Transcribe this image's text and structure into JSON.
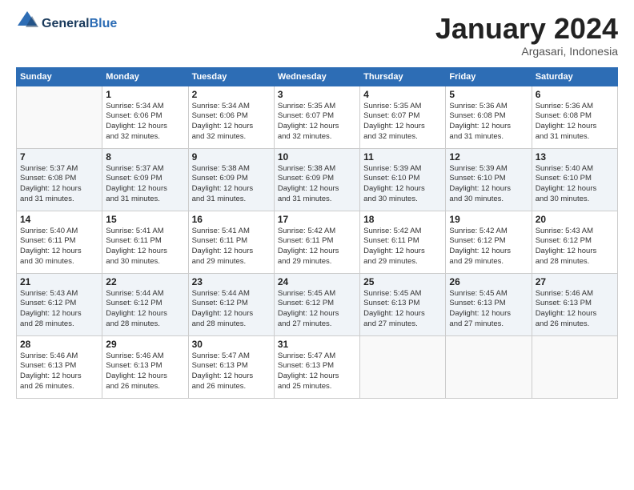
{
  "header": {
    "logo_line1": "General",
    "logo_line2": "Blue",
    "month_title": "January 2024",
    "subtitle": "Argasari, Indonesia"
  },
  "days_of_week": [
    "Sunday",
    "Monday",
    "Tuesday",
    "Wednesday",
    "Thursday",
    "Friday",
    "Saturday"
  ],
  "weeks": [
    [
      {
        "day": "",
        "info": ""
      },
      {
        "day": "1",
        "info": "Sunrise: 5:34 AM\nSunset: 6:06 PM\nDaylight: 12 hours\nand 32 minutes."
      },
      {
        "day": "2",
        "info": "Sunrise: 5:34 AM\nSunset: 6:06 PM\nDaylight: 12 hours\nand 32 minutes."
      },
      {
        "day": "3",
        "info": "Sunrise: 5:35 AM\nSunset: 6:07 PM\nDaylight: 12 hours\nand 32 minutes."
      },
      {
        "day": "4",
        "info": "Sunrise: 5:35 AM\nSunset: 6:07 PM\nDaylight: 12 hours\nand 32 minutes."
      },
      {
        "day": "5",
        "info": "Sunrise: 5:36 AM\nSunset: 6:08 PM\nDaylight: 12 hours\nand 31 minutes."
      },
      {
        "day": "6",
        "info": "Sunrise: 5:36 AM\nSunset: 6:08 PM\nDaylight: 12 hours\nand 31 minutes."
      }
    ],
    [
      {
        "day": "7",
        "info": "Sunrise: 5:37 AM\nSunset: 6:08 PM\nDaylight: 12 hours\nand 31 minutes."
      },
      {
        "day": "8",
        "info": "Sunrise: 5:37 AM\nSunset: 6:09 PM\nDaylight: 12 hours\nand 31 minutes."
      },
      {
        "day": "9",
        "info": "Sunrise: 5:38 AM\nSunset: 6:09 PM\nDaylight: 12 hours\nand 31 minutes."
      },
      {
        "day": "10",
        "info": "Sunrise: 5:38 AM\nSunset: 6:09 PM\nDaylight: 12 hours\nand 31 minutes."
      },
      {
        "day": "11",
        "info": "Sunrise: 5:39 AM\nSunset: 6:10 PM\nDaylight: 12 hours\nand 30 minutes."
      },
      {
        "day": "12",
        "info": "Sunrise: 5:39 AM\nSunset: 6:10 PM\nDaylight: 12 hours\nand 30 minutes."
      },
      {
        "day": "13",
        "info": "Sunrise: 5:40 AM\nSunset: 6:10 PM\nDaylight: 12 hours\nand 30 minutes."
      }
    ],
    [
      {
        "day": "14",
        "info": "Sunrise: 5:40 AM\nSunset: 6:11 PM\nDaylight: 12 hours\nand 30 minutes."
      },
      {
        "day": "15",
        "info": "Sunrise: 5:41 AM\nSunset: 6:11 PM\nDaylight: 12 hours\nand 30 minutes."
      },
      {
        "day": "16",
        "info": "Sunrise: 5:41 AM\nSunset: 6:11 PM\nDaylight: 12 hours\nand 29 minutes."
      },
      {
        "day": "17",
        "info": "Sunrise: 5:42 AM\nSunset: 6:11 PM\nDaylight: 12 hours\nand 29 minutes."
      },
      {
        "day": "18",
        "info": "Sunrise: 5:42 AM\nSunset: 6:11 PM\nDaylight: 12 hours\nand 29 minutes."
      },
      {
        "day": "19",
        "info": "Sunrise: 5:42 AM\nSunset: 6:12 PM\nDaylight: 12 hours\nand 29 minutes."
      },
      {
        "day": "20",
        "info": "Sunrise: 5:43 AM\nSunset: 6:12 PM\nDaylight: 12 hours\nand 28 minutes."
      }
    ],
    [
      {
        "day": "21",
        "info": "Sunrise: 5:43 AM\nSunset: 6:12 PM\nDaylight: 12 hours\nand 28 minutes."
      },
      {
        "day": "22",
        "info": "Sunrise: 5:44 AM\nSunset: 6:12 PM\nDaylight: 12 hours\nand 28 minutes."
      },
      {
        "day": "23",
        "info": "Sunrise: 5:44 AM\nSunset: 6:12 PM\nDaylight: 12 hours\nand 28 minutes."
      },
      {
        "day": "24",
        "info": "Sunrise: 5:45 AM\nSunset: 6:12 PM\nDaylight: 12 hours\nand 27 minutes."
      },
      {
        "day": "25",
        "info": "Sunrise: 5:45 AM\nSunset: 6:13 PM\nDaylight: 12 hours\nand 27 minutes."
      },
      {
        "day": "26",
        "info": "Sunrise: 5:45 AM\nSunset: 6:13 PM\nDaylight: 12 hours\nand 27 minutes."
      },
      {
        "day": "27",
        "info": "Sunrise: 5:46 AM\nSunset: 6:13 PM\nDaylight: 12 hours\nand 26 minutes."
      }
    ],
    [
      {
        "day": "28",
        "info": "Sunrise: 5:46 AM\nSunset: 6:13 PM\nDaylight: 12 hours\nand 26 minutes."
      },
      {
        "day": "29",
        "info": "Sunrise: 5:46 AM\nSunset: 6:13 PM\nDaylight: 12 hours\nand 26 minutes."
      },
      {
        "day": "30",
        "info": "Sunrise: 5:47 AM\nSunset: 6:13 PM\nDaylight: 12 hours\nand 26 minutes."
      },
      {
        "day": "31",
        "info": "Sunrise: 5:47 AM\nSunset: 6:13 PM\nDaylight: 12 hours\nand 25 minutes."
      },
      {
        "day": "",
        "info": ""
      },
      {
        "day": "",
        "info": ""
      },
      {
        "day": "",
        "info": ""
      }
    ]
  ]
}
